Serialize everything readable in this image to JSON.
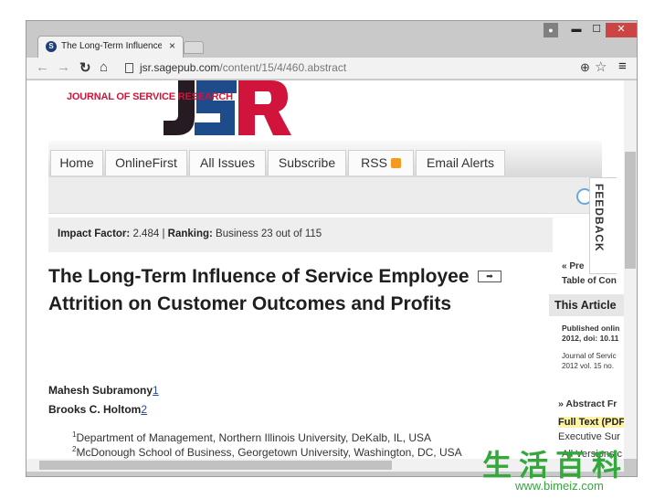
{
  "browser": {
    "tab_title": "The Long-Term Influence",
    "tab_close": "×",
    "url_host": "jsr.sagepub.com",
    "url_path": "/content/15/4/460.abstract",
    "window_controls": {
      "minimize": "▬",
      "maximize": "☐",
      "close": "✕"
    },
    "icons": [
      "back-arrow-icon",
      "forward-arrow-icon",
      "reload-icon",
      "home-icon",
      "zoom-icon",
      "star-icon",
      "menu-icon",
      "user-icon"
    ]
  },
  "page": {
    "journal_name": "JOURNAL OF SERVICE RESEARCH",
    "nav_tabs": [
      "Home",
      "OnlineFirst",
      "All Issues",
      "Subscribe",
      "RSS",
      "Email Alerts"
    ],
    "impact": {
      "factor_label": "Impact Factor:",
      "factor_value": "2.484",
      "separator": "|",
      "ranking_label": "Ranking:",
      "ranking_value": "Business 23 out of 115"
    },
    "title": "The Long-Term Influence of Service Employee Attrition on Customer Outcomes and Profits",
    "authors": [
      {
        "name": "Mahesh Subramony",
        "link": "1"
      },
      {
        "name": "Brooks C. Holtom",
        "link": "2"
      }
    ],
    "affiliations": [
      {
        "num": "1",
        "text": "Department of Management, Northern Illinois University, DeKalb, IL, USA"
      },
      {
        "num": "2",
        "text": "McDonough School of Business, Georgetown University, Washington, DC, USA"
      }
    ],
    "feedback": "FEEDBACK",
    "sidebar": {
      "prev": "« Pre",
      "toc": "Table of Con",
      "this_article": "This Article",
      "published_1": "Published onlin",
      "published_2": "2012, doi: 10.11",
      "journal_1": "Journal of Servic",
      "journal_2": "2012 vol. 15 no.",
      "abstract": "» Abstract Fr",
      "full_text": "Full Text (PDF",
      "exec": "Executive Sur",
      "all_versions": "All Versions c"
    }
  },
  "watermark": {
    "chinese": "生活百科",
    "url": "www.bimeiz.com"
  },
  "colors": {
    "brand_red": "#d0143b",
    "brand_navy": "#1e4c8a",
    "link": "#2a4a9a",
    "highlight": "#fff3a6",
    "watermark": "#34a83c"
  }
}
